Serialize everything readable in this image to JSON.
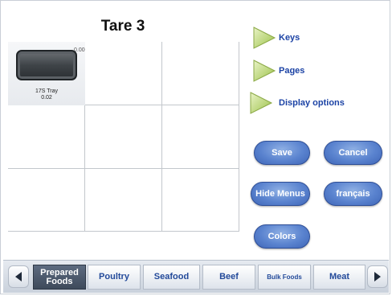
{
  "title": "Tare 3",
  "grid": {
    "tile": {
      "name": "17S Tray",
      "price": "0.02",
      "weight": "0.000"
    }
  },
  "menu_links": [
    {
      "label": "Keys",
      "icon": "triangle-right-icon"
    },
    {
      "label": "Pages",
      "icon": "triangle-right-icon"
    },
    {
      "label": "Display options",
      "icon": "triangle-right-icon"
    }
  ],
  "buttons": {
    "save": "Save",
    "cancel": "Cancel",
    "hide_menus": "Hide Menus",
    "language": "français",
    "colors": "Colors"
  },
  "tabs": [
    {
      "label": "Prepared Foods",
      "active": true
    },
    {
      "label": "Poultry",
      "active": false
    },
    {
      "label": "Seafood",
      "active": false
    },
    {
      "label": "Beef",
      "active": false
    },
    {
      "label": "Bulk Foods",
      "active": false
    },
    {
      "label": "Meat",
      "active": false
    }
  ],
  "nav": {
    "prev_icon": "chevron-left-icon",
    "next_icon": "chevron-right-icon"
  },
  "colors": {
    "accent": "#1c43a5",
    "button": "#5a83cf",
    "active_tab": "#4a5668",
    "arrow": "#b5d36a"
  }
}
